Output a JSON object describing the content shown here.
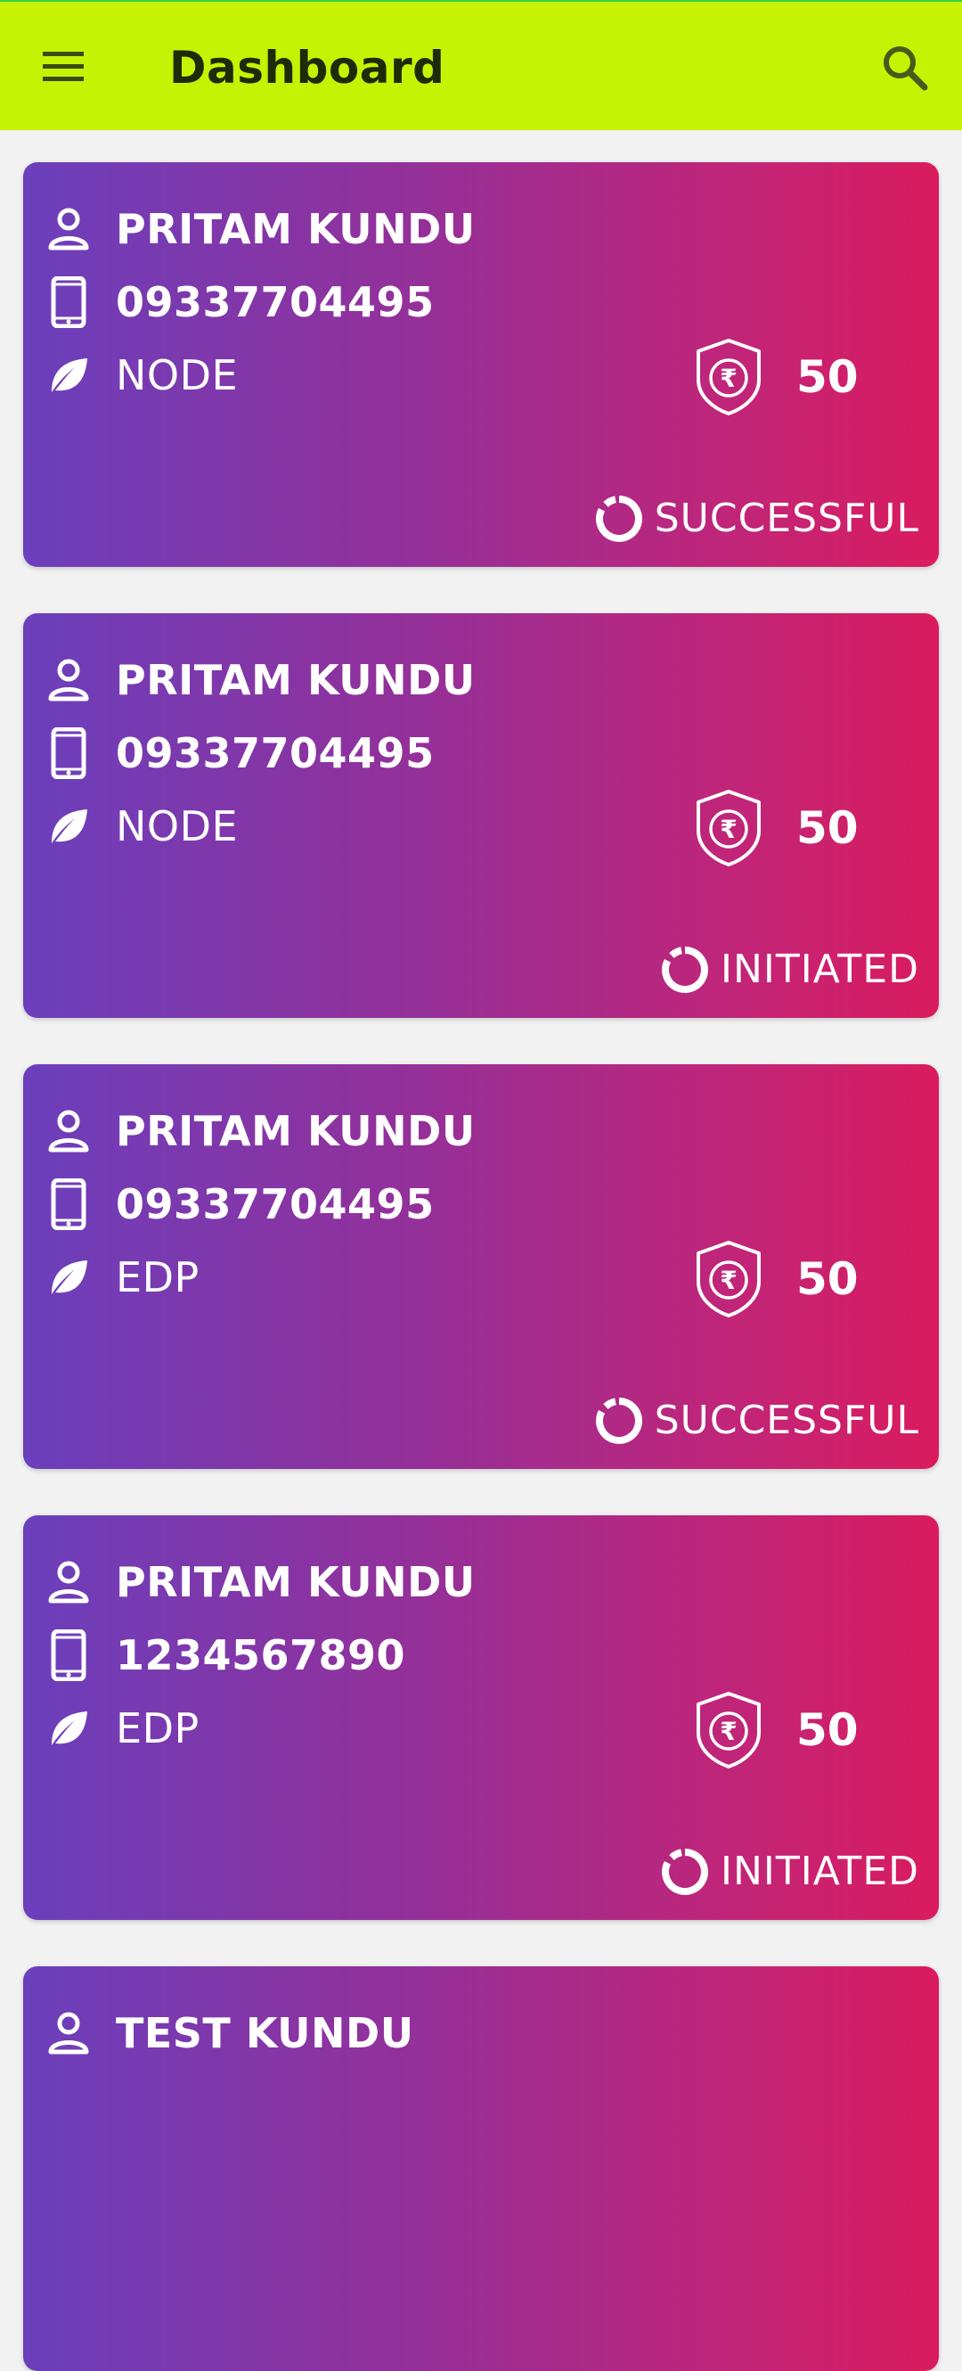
{
  "app": {
    "title": "Dashboard"
  },
  "colors": {
    "app_bar": "#c6f204",
    "card_gradient_start": "#6b3fbc",
    "card_gradient_end": "#da1b5d",
    "background": "#f2f2f2"
  },
  "icons": {
    "menu": "menu-icon",
    "search": "search-icon",
    "name": "person-icon",
    "phone": "smartphone-icon",
    "type": "leaf-icon",
    "amount": "rupee-shield-icon",
    "status": "status-ring-icon"
  },
  "transactions": [
    {
      "name": "PRITAM KUNDU",
      "phone": "09337704495",
      "type": "NODE",
      "amount": "50",
      "status": "SUCCESSFUL"
    },
    {
      "name": "PRITAM KUNDU",
      "phone": "09337704495",
      "type": "NODE",
      "amount": "50",
      "status": "INITIATED"
    },
    {
      "name": "PRITAM KUNDU",
      "phone": "09337704495",
      "type": "EDP",
      "amount": "50",
      "status": "SUCCESSFUL"
    },
    {
      "name": "PRITAM KUNDU",
      "phone": "1234567890",
      "type": "EDP",
      "amount": "50",
      "status": "INITIATED"
    },
    {
      "name": "TEST KUNDU"
    }
  ]
}
